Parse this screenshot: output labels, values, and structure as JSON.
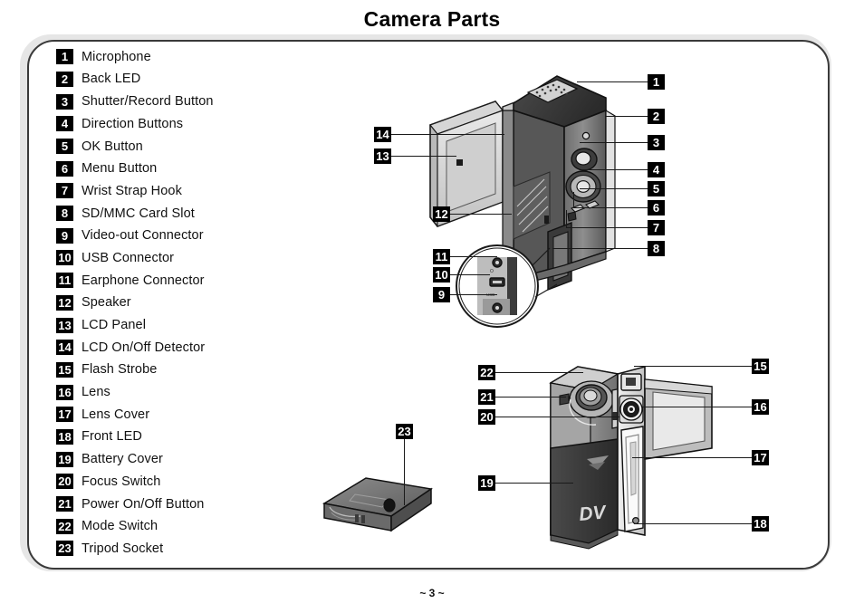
{
  "document": {
    "title": "Camera Parts",
    "page_footer": "~ 3 ~"
  },
  "legend": {
    "items": [
      {
        "num": "1",
        "label": "Microphone"
      },
      {
        "num": "2",
        "label": "Back LED"
      },
      {
        "num": "3",
        "label": "Shutter/Record Button"
      },
      {
        "num": "4",
        "label": "Direction Buttons"
      },
      {
        "num": "5",
        "label": "OK Button"
      },
      {
        "num": "6",
        "label": "Menu Button"
      },
      {
        "num": "7",
        "label": "Wrist Strap Hook"
      },
      {
        "num": "8",
        "label": "SD/MMC Card Slot"
      },
      {
        "num": "9",
        "label": "Video-out Connector"
      },
      {
        "num": "10",
        "label": "USB Connector"
      },
      {
        "num": "11",
        "label": "Earphone Connector"
      },
      {
        "num": "12",
        "label": "Speaker"
      },
      {
        "num": "13",
        "label": "LCD Panel"
      },
      {
        "num": "14",
        "label": "LCD On/Off Detector"
      },
      {
        "num": "15",
        "label": "Flash Strobe"
      },
      {
        "num": "16",
        "label": "Lens"
      },
      {
        "num": "17",
        "label": "Lens Cover"
      },
      {
        "num": "18",
        "label": "Front LED"
      },
      {
        "num": "19",
        "label": "Battery Cover"
      },
      {
        "num": "20",
        "label": "Focus Switch"
      },
      {
        "num": "21",
        "label": "Power On/Off Button"
      },
      {
        "num": "22",
        "label": "Mode Switch"
      },
      {
        "num": "23",
        "label": "Tripod Socket"
      }
    ]
  },
  "diagrams": {
    "rear_view": {
      "name": "Camera rear/side view with LCD panel open",
      "callouts": [
        "1",
        "2",
        "3",
        "4",
        "5",
        "6",
        "7",
        "8",
        "9",
        "10",
        "11",
        "12",
        "13",
        "14"
      ],
      "detail_circle_label": "connector-port-detail",
      "port_markings": [
        "USB"
      ]
    },
    "front_view": {
      "name": "Camera front view with lens and battery cover",
      "callouts": [
        "15",
        "16",
        "17",
        "18",
        "19",
        "20",
        "21",
        "22"
      ],
      "body_logo": "DV"
    },
    "bottom_view": {
      "name": "Camera bottom view showing tripod socket",
      "callouts": [
        "23"
      ]
    }
  },
  "colors": {
    "badge_bg": "#000000",
    "badge_text": "#ffffff",
    "frame_border": "#3a3a3a",
    "frame_shadow": "#e6e6e6",
    "body_dark": "#3f3f3f",
    "body_mid": "#808080",
    "body_light": "#d8d8d8",
    "page_bg": "#ffffff"
  }
}
